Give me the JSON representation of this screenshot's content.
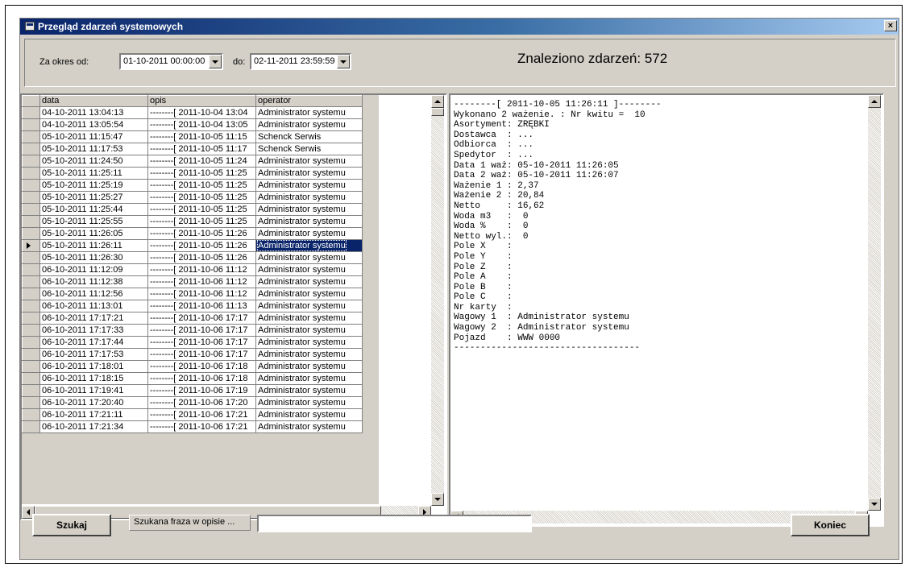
{
  "window": {
    "title": "Przegląd zdarzeń systemowych",
    "close_glyph": "×"
  },
  "filter": {
    "from_label": "Za okres od:",
    "from_value": "01-10-2011 00:00:00",
    "to_label": "do:",
    "to_value": "02-11-2011 23:59:59",
    "found_text": "Znaleziono zdarzeń: 572"
  },
  "grid": {
    "columns": [
      "data",
      "opis",
      "operator"
    ],
    "selected_index": 11,
    "rows": [
      {
        "data": "04-10-2011 13:04:13",
        "opis": "--------[ 2011-10-04 13:04",
        "operator": "Administrator systemu"
      },
      {
        "data": "04-10-2011 13:05:54",
        "opis": "--------[ 2011-10-04 13:05",
        "operator": "Administrator systemu"
      },
      {
        "data": "05-10-2011 11:15:47",
        "opis": "--------[ 2011-10-05 11:15",
        "operator": "Schenck Serwis"
      },
      {
        "data": "05-10-2011 11:17:53",
        "opis": "--------[ 2011-10-05 11:17",
        "operator": "Schenck Serwis"
      },
      {
        "data": "05-10-2011 11:24:50",
        "opis": "--------[ 2011-10-05 11:24",
        "operator": "Administrator systemu"
      },
      {
        "data": "05-10-2011 11:25:11",
        "opis": "--------[ 2011-10-05 11:25",
        "operator": "Administrator systemu"
      },
      {
        "data": "05-10-2011 11:25:19",
        "opis": "--------[ 2011-10-05 11:25",
        "operator": "Administrator systemu"
      },
      {
        "data": "05-10-2011 11:25:27",
        "opis": "--------[ 2011-10-05 11:25",
        "operator": "Administrator systemu"
      },
      {
        "data": "05-10-2011 11:25:44",
        "opis": "--------[ 2011-10-05 11:25",
        "operator": "Administrator systemu"
      },
      {
        "data": "05-10-2011 11:25:55",
        "opis": "--------[ 2011-10-05 11:25",
        "operator": "Administrator systemu"
      },
      {
        "data": "05-10-2011 11:26:05",
        "opis": "--------[ 2011-10-05 11:26",
        "operator": "Administrator systemu"
      },
      {
        "data": "05-10-2011 11:26:11",
        "opis": "--------[ 2011-10-05 11:26",
        "operator": "Administrator systemu"
      },
      {
        "data": "05-10-2011 11:26:30",
        "opis": "--------[ 2011-10-05 11:26",
        "operator": "Administrator systemu"
      },
      {
        "data": "06-10-2011 11:12:09",
        "opis": "--------[ 2011-10-06 11:12",
        "operator": "Administrator systemu"
      },
      {
        "data": "06-10-2011 11:12:38",
        "opis": "--------[ 2011-10-06 11:12",
        "operator": "Administrator systemu"
      },
      {
        "data": "06-10-2011 11:12:56",
        "opis": "--------[ 2011-10-06 11:12",
        "operator": "Administrator systemu"
      },
      {
        "data": "06-10-2011 11:13:01",
        "opis": "--------[ 2011-10-06 11:13",
        "operator": "Administrator systemu"
      },
      {
        "data": "06-10-2011 17:17:21",
        "opis": "--------[ 2011-10-06 17:17",
        "operator": "Administrator systemu"
      },
      {
        "data": "06-10-2011 17:17:33",
        "opis": "--------[ 2011-10-06 17:17",
        "operator": "Administrator systemu"
      },
      {
        "data": "06-10-2011 17:17:44",
        "opis": "--------[ 2011-10-06 17:17",
        "operator": "Administrator systemu"
      },
      {
        "data": "06-10-2011 17:17:53",
        "opis": "--------[ 2011-10-06 17:17",
        "operator": "Administrator systemu"
      },
      {
        "data": "06-10-2011 17:18:01",
        "opis": "--------[ 2011-10-06 17:18",
        "operator": "Administrator systemu"
      },
      {
        "data": "06-10-2011 17:18:15",
        "opis": "--------[ 2011-10-06 17:18",
        "operator": "Administrator systemu"
      },
      {
        "data": "06-10-2011 17:19:41",
        "opis": "--------[ 2011-10-06 17:19",
        "operator": "Administrator systemu"
      },
      {
        "data": "06-10-2011 17:20:40",
        "opis": "--------[ 2011-10-06 17:20",
        "operator": "Administrator systemu"
      },
      {
        "data": "06-10-2011 17:21:11",
        "opis": "--------[ 2011-10-06 17:21",
        "operator": "Administrator systemu"
      },
      {
        "data": "06-10-2011 17:21:34",
        "opis": "--------[ 2011-10-06 17:21",
        "operator": "Administrator systemu"
      }
    ]
  },
  "detail": {
    "lines": [
      "--------[ 2011-10-05 11:26:11 ]--------",
      "Wykonano 2 ważenie. : Nr kwitu =  10",
      "Asortyment: ZRĘBKI",
      "Dostawca  : ...",
      "Odbiorca  : ...",
      "Spedytor  : ...",
      "Data 1 waż: 05-10-2011 11:26:05",
      "Data 2 waż: 05-10-2011 11:26:07",
      "Ważenie 1 : 2,37",
      "Ważenie 2 : 20,84",
      "Netto     : 16,62",
      "Woda m3   :  0",
      "Woda %    :  0",
      "Netto wyl.:  0",
      "Pole X    :",
      "Pole Y    :",
      "Pole Z    :",
      "Pole A    :",
      "Pole B    :",
      "Pole C    :",
      "Nr karty  :",
      "Wagowy 1  : Administrator systemu",
      "Wagowy 2  : Administrator systemu",
      "Pojazd    : WWW 0000",
      "-----------------------------------"
    ]
  },
  "bottom": {
    "search_button": "Szukaj",
    "search_label": "Szukana fraza w opisie ...",
    "search_value": "",
    "end_button": "Koniec"
  }
}
